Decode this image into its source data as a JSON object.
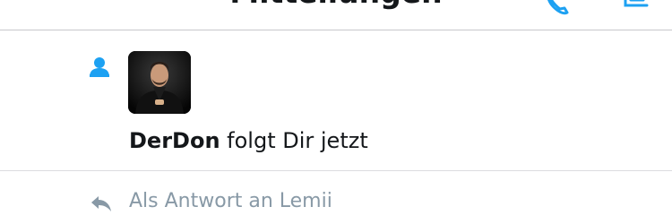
{
  "header": {
    "title": "Mitteilungen"
  },
  "notification": {
    "type_icon": "follow-person-icon",
    "user_name": "DerDon",
    "action_text": " folgt Dir jetzt"
  },
  "reply": {
    "icon": "reply-arrow-icon",
    "text": "Als Antwort an Lemii"
  },
  "colors": {
    "accent": "#1da1f2",
    "muted": "#8899a6",
    "text": "#14171a",
    "divider": "#c8c7cc"
  }
}
